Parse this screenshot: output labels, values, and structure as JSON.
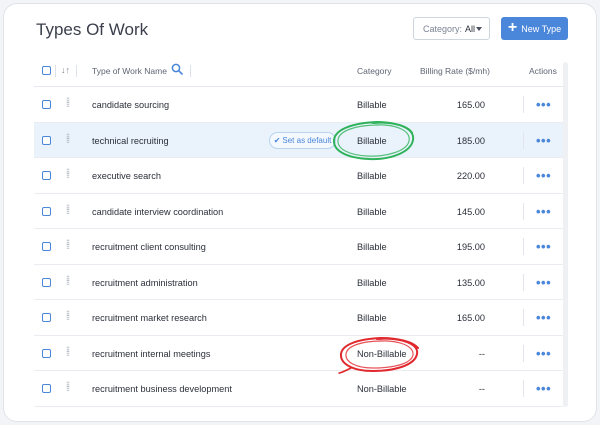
{
  "page": {
    "title": "Types Of Work"
  },
  "toolbar": {
    "category_label": "Category:",
    "category_value": "All",
    "new_type_label": "New Type"
  },
  "table": {
    "columns": {
      "name": "Type of Work Name",
      "category": "Category",
      "rate": "Billing Rate ($/mh)",
      "actions": "Actions"
    },
    "set_default_label": "Set as default",
    "rows": [
      {
        "name": "candidate sourcing",
        "category": "Billable",
        "rate": "165.00"
      },
      {
        "name": "technical recruiting",
        "category": "Billable",
        "rate": "185.00"
      },
      {
        "name": "executive search",
        "category": "Billable",
        "rate": "220.00"
      },
      {
        "name": "candidate interview coordination",
        "category": "Billable",
        "rate": "145.00"
      },
      {
        "name": "recruitment client consulting",
        "category": "Billable",
        "rate": "195.00"
      },
      {
        "name": "recruitment administration",
        "category": "Billable",
        "rate": "135.00"
      },
      {
        "name": "recruitment market research",
        "category": "Billable",
        "rate": "165.00"
      },
      {
        "name": "recruitment internal meetings",
        "category": "Non-Billable",
        "rate": "--"
      },
      {
        "name": "recruitment business development",
        "category": "Non-Billable",
        "rate": "--"
      }
    ]
  },
  "colors": {
    "accent": "#4a86d9",
    "highlight_row": "#eaf3fc",
    "annotation_green": "#2fb35a",
    "annotation_red": "#e0282e"
  }
}
